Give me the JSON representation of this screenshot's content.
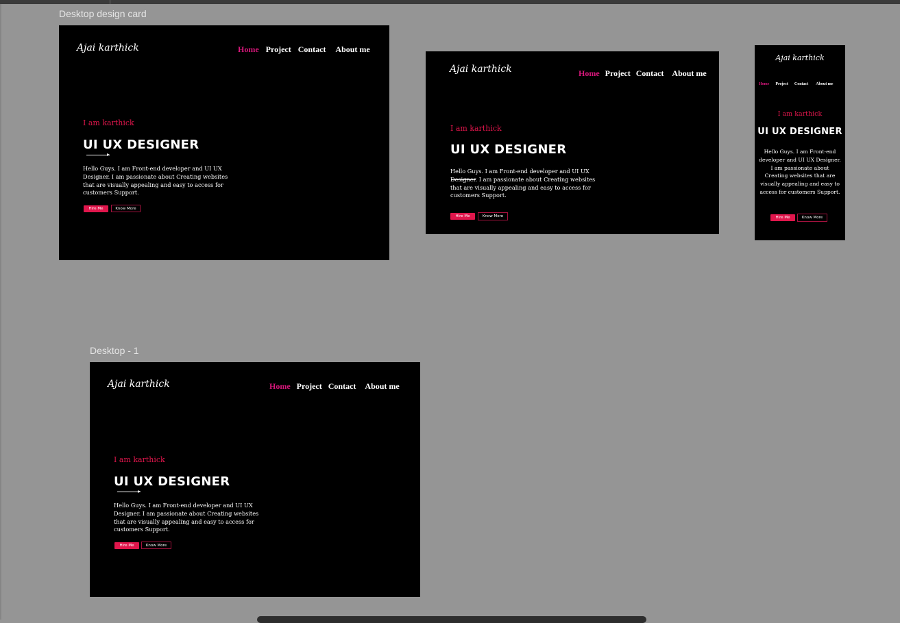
{
  "canvas": {
    "background": "#959595",
    "accent_pink": "#d6177a",
    "accent_red": "#e0164c"
  },
  "frames": [
    {
      "label": "Desktop design card",
      "logo": "Ajai karthick",
      "nav": [
        "Home",
        "Project",
        "Contact",
        "About me"
      ],
      "eyebrow": "I am karthick",
      "headline": "UI UX DESIGNER",
      "description": "Hello Guys. I am Front-end  developer and UI UX Designer. I am passionate about Creating websites that are visually appealing and easy to access  for customers Support.",
      "hire_button": "Hire Me",
      "know_button": "Know More"
    },
    {
      "label": "",
      "logo": "Ajai karthick",
      "nav": [
        "Home",
        "Project",
        "Contact",
        "About me"
      ],
      "eyebrow": "I am karthick",
      "headline": "UI UX DESIGNER",
      "description": "Hello Guys. I am Front-end  developer and UI UX Designer. I am passionate about Creating websites that are visually appealing and easy to access  for customers Support.",
      "hire_button": "Hire Me",
      "know_button": "Know More"
    },
    {
      "label": "",
      "logo": "Ajai  karthick",
      "nav": [
        "Home",
        "Project",
        "Contact",
        "About me"
      ],
      "eyebrow": "I am karthick",
      "headline": "UI UX DESIGNER",
      "description": "Hello Guys. I am Front-end developer and UI UX Designer. I am passionate about Creating websites that are visually appealing and easy to access  for customers Support.",
      "hire_button": "Hire Me",
      "know_button": "Know More"
    },
    {
      "label": "Desktop - 1",
      "logo": "Ajai karthick",
      "nav": [
        "Home",
        "Project",
        "Contact",
        "About me"
      ],
      "eyebrow": "I am karthick",
      "headline": "UI UX DESIGNER",
      "description": "Hello Guys. I am Front-end  developer and UI UX Designer. I am passionate about Creating websites that are visually appealing and easy to access  for customers Support.",
      "hire_button": "Hire Me",
      "know_button": "Know More"
    }
  ]
}
